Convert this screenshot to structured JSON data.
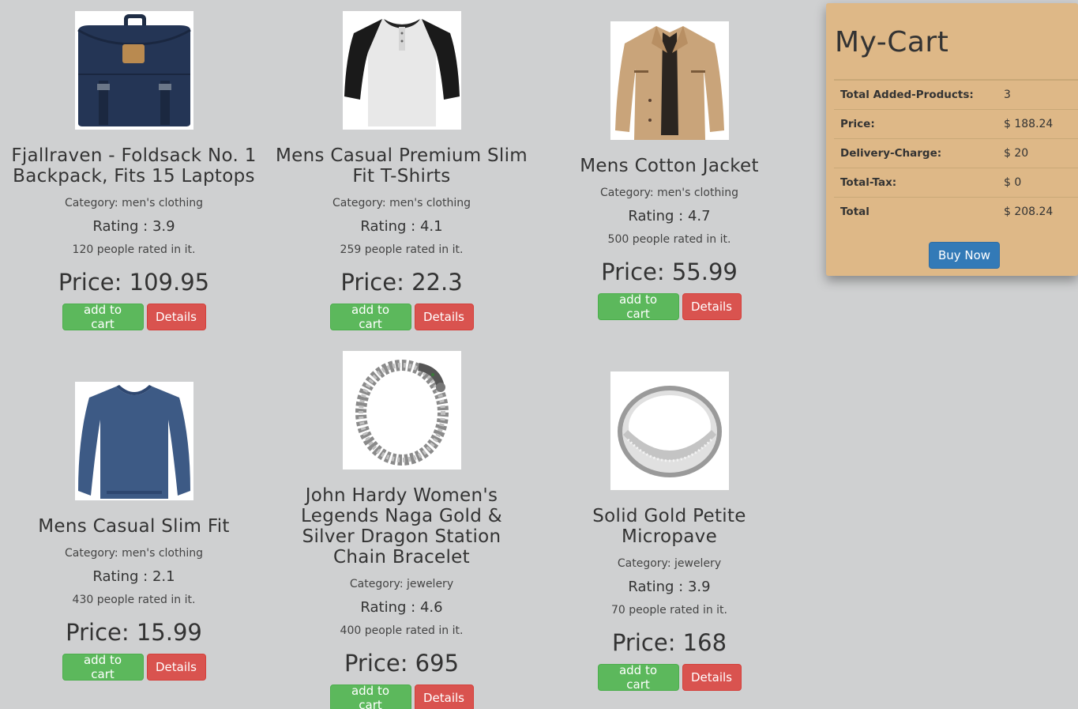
{
  "products": [
    {
      "image": "backpack-image",
      "title": "Fjallraven - Foldsack No. 1 Backpack, Fits 15 Laptops",
      "category": "Category: men's clothing",
      "rating": "Rating : 3.9",
      "rated": "120 people rated in it.",
      "price": "Price: 109.95",
      "add_label": "add to cart",
      "details_label": "Details"
    },
    {
      "image": "tshirt-image",
      "title": "Mens Casual Premium Slim Fit T-Shirts",
      "category": "Category: men's clothing",
      "rating": "Rating : 4.1",
      "rated": "259 people rated in it.",
      "price": "Price: 22.3",
      "add_label": "add to cart",
      "details_label": "Details"
    },
    {
      "image": "jacket-image",
      "title": "Mens Cotton Jacket",
      "category": "Category: men's clothing",
      "rating": "Rating : 4.7",
      "rated": "500 people rated in it.",
      "price": "Price: 55.99",
      "add_label": "add to cart",
      "details_label": "Details"
    },
    {
      "image": "sweater-image",
      "title": "Mens Casual Slim Fit",
      "category": "Category: men's clothing",
      "rating": "Rating : 2.1",
      "rated": "430 people rated in it.",
      "price": "Price: 15.99",
      "add_label": "add to cart",
      "details_label": "Details"
    },
    {
      "image": "bracelet-image",
      "title": "John Hardy Women's Legends Naga Gold & Silver Dragon Station Chain Bracelet",
      "category": "Category: jewelery",
      "rating": "Rating : 4.6",
      "rated": "400 people rated in it.",
      "price": "Price: 695",
      "add_label": "add to cart",
      "details_label": "Details"
    },
    {
      "image": "ring-image",
      "title": "Solid Gold Petite Micropave",
      "category": "Category: jewelery",
      "rating": "Rating : 3.9",
      "rated": "70 people rated in it.",
      "price": "Price: 168",
      "add_label": "add to cart",
      "details_label": "Details"
    }
  ],
  "cart": {
    "title": "My-Cart",
    "rows": [
      {
        "label": "Total Added-Products:",
        "value": "3"
      },
      {
        "label": "Price:",
        "value": "$ 188.24"
      },
      {
        "label": "Delivery-Charge:",
        "value": "$ 20"
      },
      {
        "label": "Total-Tax:",
        "value": "$ 0"
      },
      {
        "label": "Total",
        "value": "$ 208.24"
      }
    ],
    "buy_label": "Buy Now"
  },
  "colors": {
    "background": "#cfd0d1",
    "cart_background": "#deb887",
    "add_button": "#5cb85c",
    "details_button": "#d9534f",
    "buy_button": "#337ab7"
  }
}
